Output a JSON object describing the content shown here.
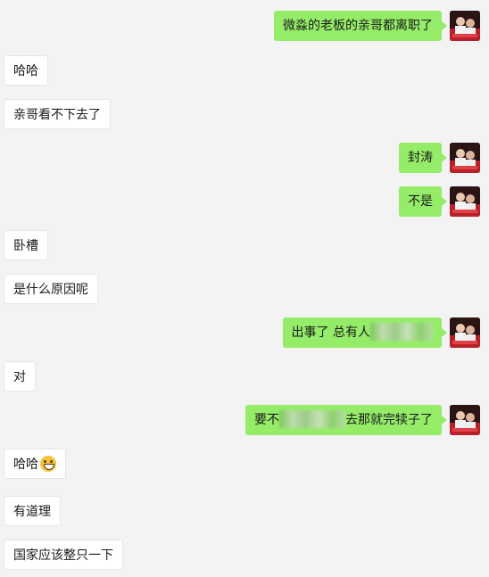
{
  "messages": [
    {
      "side": "out",
      "text": "微淼的老板的亲哥都离职了"
    },
    {
      "side": "in",
      "text": "哈哈"
    },
    {
      "side": "in",
      "text": "亲哥看不下去了"
    },
    {
      "side": "out",
      "text": "封涛"
    },
    {
      "side": "out",
      "text": "不是"
    },
    {
      "side": "in",
      "text": "卧槽"
    },
    {
      "side": "in",
      "text": "是什么原因呢"
    },
    {
      "side": "out",
      "text_before": "出事了 总有人",
      "text_after": ""
    },
    {
      "side": "in",
      "text": "对"
    },
    {
      "side": "out",
      "text_before": "要不",
      "text_after": "去那就完犊子了"
    },
    {
      "side": "in",
      "text": "哈哈",
      "emoji": "grinning-face-emoji"
    },
    {
      "side": "in",
      "text": "有道理"
    },
    {
      "side": "in",
      "text": "国家应该整只一下"
    }
  ],
  "colors": {
    "background": "#f3f3f3",
    "outgoing_bubble": "#95ec69",
    "incoming_bubble": "#ffffff"
  }
}
